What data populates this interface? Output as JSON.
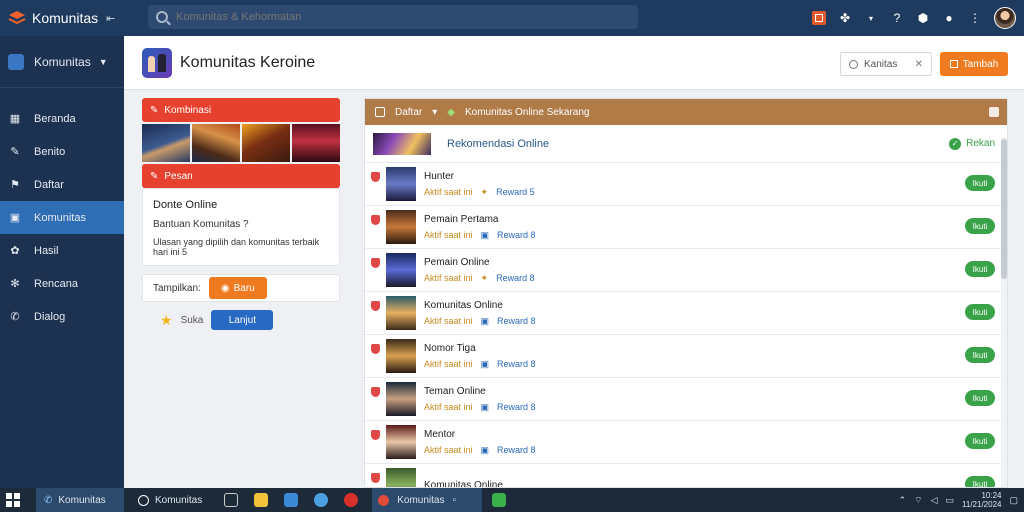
{
  "app": {
    "title": "Komunitas"
  },
  "search": {
    "placeholder": "Komunitas & Kehormatan"
  },
  "sidebar": {
    "header": "Komunitas",
    "items": [
      {
        "label": "Beranda",
        "icon": "grid-icon"
      },
      {
        "label": "Benito",
        "icon": "wrench-icon"
      },
      {
        "label": "Daftar",
        "icon": "bookmark-icon"
      },
      {
        "label": "Komunitas",
        "icon": "window-icon",
        "active": true
      },
      {
        "label": "Hasil",
        "icon": "gear-icon"
      },
      {
        "label": "Rencana",
        "icon": "cog-icon"
      },
      {
        "label": "Dialog",
        "icon": "chat-icon"
      }
    ]
  },
  "page": {
    "title": "Komunitas  Keroine",
    "filter_text": "Kanitas",
    "action_label": "Tambah"
  },
  "left": {
    "section1": "Kombinasi",
    "section2": "Pesan",
    "online_title": "Donte Online",
    "online_question": "Bantuan Komunitas ?",
    "online_sub": "Ulasan yang dipilih dan komunitas terbaik hari ini  5",
    "display_label": "Tampilkan:",
    "display_button": "Baru",
    "star_label": "Suka",
    "blue_button": "Lanjut"
  },
  "right": {
    "tab1": "Daftar",
    "tab2": "Komunitas Online Sekarang",
    "featured_title": "Rekomendasi Online",
    "featured_status": "Rekan",
    "rows": [
      {
        "name": "Hunter",
        "meta1": "Aktif saat ini",
        "meta2": "Reward 5",
        "pill": "Ikuti"
      },
      {
        "name": "Pemain Pertama",
        "meta1": "Aktif saat ini",
        "meta2": "Reward 8",
        "pill": "Ikuti"
      },
      {
        "name": "Pemain Online",
        "meta1": "Aktif saat ini",
        "meta2": "Reward 8",
        "pill": "Ikuti"
      },
      {
        "name": "Komunitas Online",
        "meta1": "Aktif saat ini",
        "meta2": "Reward 8",
        "pill": "Ikuti"
      },
      {
        "name": "Nomor Tiga",
        "meta1": "Aktif saat ini",
        "meta2": "Reward 8",
        "pill": "Ikuti"
      },
      {
        "name": "Teman Online",
        "meta1": "Aktif saat ini",
        "meta2": "Reward 8",
        "pill": "Ikuti"
      },
      {
        "name": "Mentor",
        "meta1": "Aktif saat ini",
        "meta2": "Reward 8",
        "pill": "Ikuti"
      },
      {
        "name": "Komunitas Online",
        "meta1": "",
        "meta2": "",
        "pill": "Ikuti"
      }
    ]
  },
  "taskbar": {
    "active": "Komunitas",
    "search": "Komunitas",
    "tab": "Komunitas",
    "time": "10:24",
    "date": "11/21/2024"
  },
  "colors": {
    "topbar": "#1f3a5f",
    "sidebar": "#1d3150",
    "accent": "#f07a1f",
    "danger": "#e6412f",
    "success": "#3aa34a",
    "panel_head": "#b07b46"
  }
}
